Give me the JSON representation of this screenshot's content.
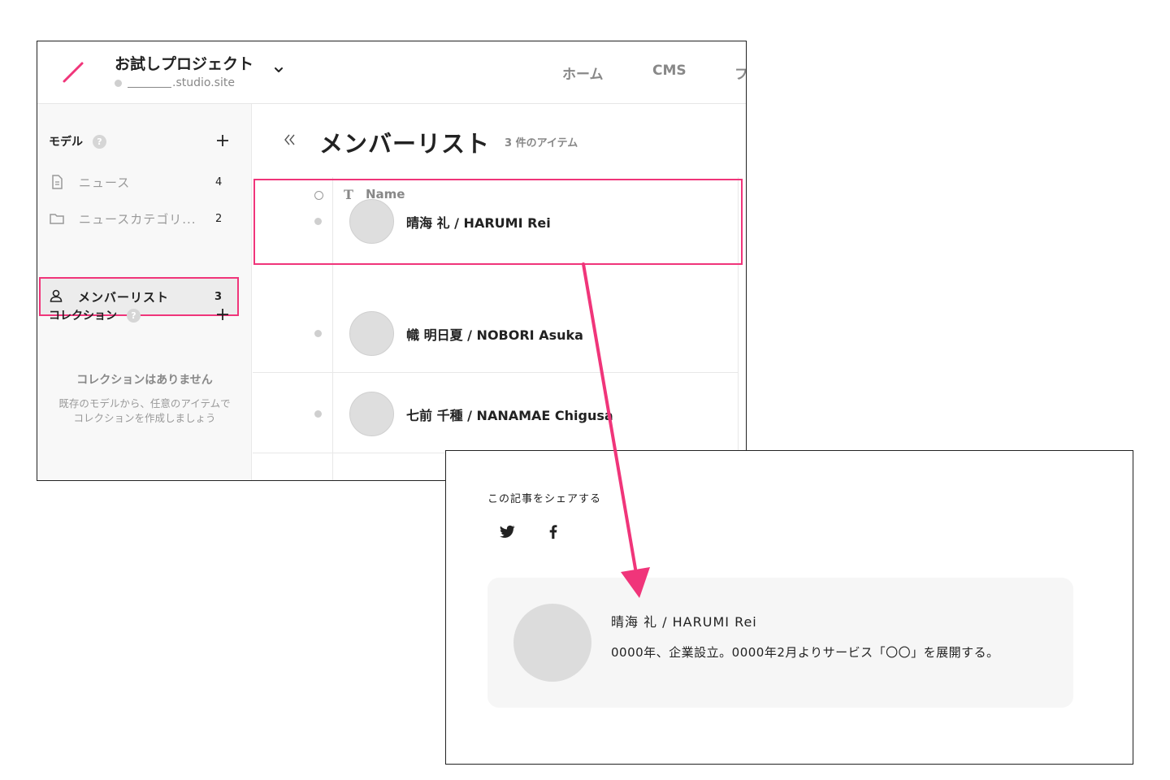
{
  "colors": {
    "accent": "#f0357a",
    "text": "#222222",
    "muted": "#888888"
  },
  "cms": {
    "header": {
      "project_title": "お試しプロジェクト",
      "project_url_suffix": ".studio.site",
      "nav": {
        "home": "ホーム",
        "cms": "CMS",
        "more": "フ"
      }
    },
    "sidebar": {
      "models_title": "モデル",
      "help_mark": "?",
      "models": [
        {
          "label": "ニュース",
          "count": "4",
          "icon": "document-icon"
        },
        {
          "label": "ニュースカテゴリ...",
          "count": "2",
          "icon": "folder-icon"
        },
        {
          "label": "メンバーリスト",
          "count": "3",
          "icon": "person-icon"
        }
      ],
      "collections_title": "コレクション",
      "empty_title": "コレクションはありません",
      "empty_desc_1": "既存のモデルから、任意のアイテムで",
      "empty_desc_2": "コレクションを作成しましょう"
    },
    "main": {
      "title": "メンバーリスト",
      "count_label": "3 件のアイテム",
      "column_type_icon": "T",
      "column_name": "Name",
      "rows": [
        {
          "name": "晴海 礼 / HARUMI Rei"
        },
        {
          "name": "幟 明日夏 / NOBORI Asuka"
        },
        {
          "name": "七前 千種 / NANAMAE Chigusa"
        }
      ]
    }
  },
  "preview": {
    "share_label": "この記事をシェアする",
    "share_icons": [
      "twitter-icon",
      "facebook-icon"
    ],
    "author": {
      "name": "晴海 礼 / HARUMI Rei",
      "bio": "0000年、企業設立。0000年2月よりサービス「〇〇」を展開する。"
    }
  }
}
